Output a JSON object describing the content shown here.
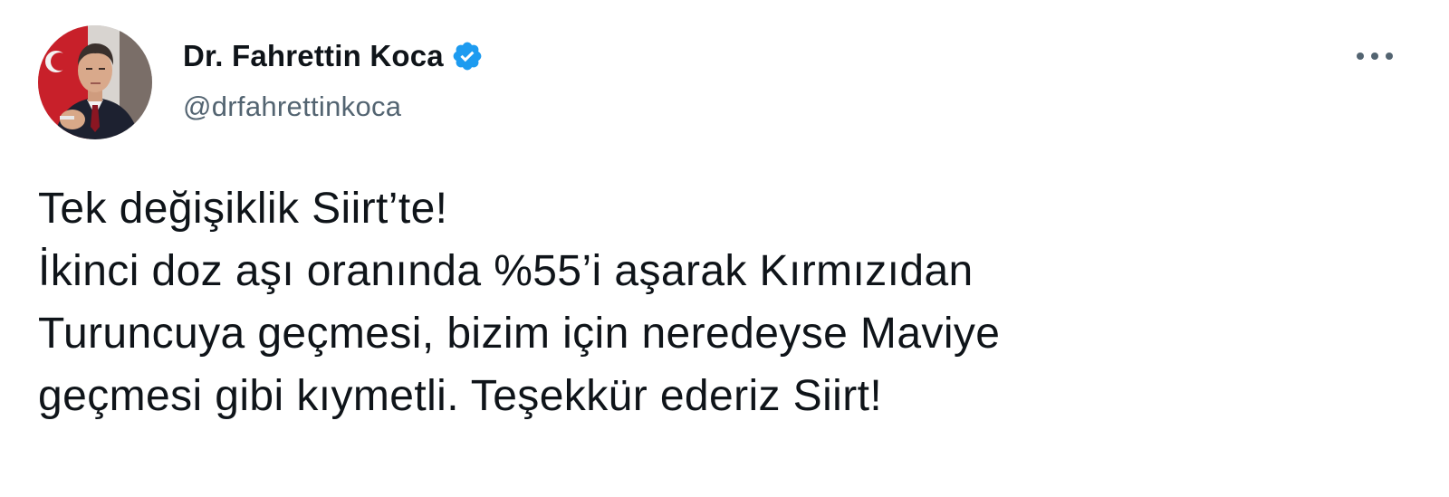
{
  "author": {
    "display_name": "Dr. Fahrettin Koca",
    "handle": "@drfahrettinkoca",
    "verified": true,
    "verified_color": "#1d9bf0"
  },
  "tweet": {
    "lines": [
      "Tek değişiklik Siirt’te!",
      "İkinci doz aşı oranında %55’i aşarak Kırmızıdan",
      "Turuncuya geçmesi, bizim için neredeyse Maviye",
      "geçmesi gibi kıymetli. Teşekkür ederiz Siirt!"
    ]
  },
  "icons": {
    "verified": "verified-badge-icon",
    "more": "more-options-icon",
    "avatar": "profile-photo"
  },
  "colors": {
    "text_primary": "#0f1419",
    "text_secondary": "#536471",
    "background": "#ffffff"
  }
}
